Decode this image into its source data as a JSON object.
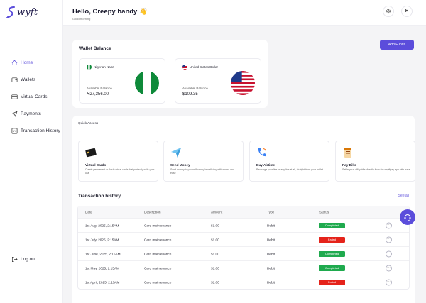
{
  "app": {
    "logo_text": "wyft",
    "brand_color": "#5b4ddb"
  },
  "sidebar": {
    "items": [
      {
        "label": "Home",
        "icon": "home-icon",
        "active": true
      },
      {
        "label": "Wallets",
        "icon": "wallet-icon"
      },
      {
        "label": "Virtual Cards",
        "icon": "card-icon"
      },
      {
        "label": "Payments",
        "icon": "send-icon"
      },
      {
        "label": "Transaction History",
        "icon": "history-icon"
      }
    ],
    "logout_label": "Log out"
  },
  "header": {
    "greeting": "Hello, Creepy handy 👋",
    "subtitle": "Good morning",
    "settings_icon": "gear-icon",
    "avatar_initial": "H"
  },
  "wallet": {
    "title": "Wallet Balance",
    "add_funds_label": "Add Funds",
    "balances": [
      {
        "currency": "Nigerian Naira",
        "label": "Available Balance",
        "amount": "₦27,356.00",
        "flag": "nigeria-flag"
      },
      {
        "currency": "United States Dollar",
        "label": "Available Balance",
        "amount": "$109.35",
        "flag": "usa-flag"
      }
    ]
  },
  "quick_access": {
    "title": "Quick Access",
    "items": [
      {
        "title": "Virtual Cards",
        "desc": "Create permanent or flash virtual cards that perfectly suits your use",
        "icon": "card-icon"
      },
      {
        "title": "Send Money",
        "desc": "Send money to yourself or any beneficiary with speed and ease",
        "icon": "paper-plane-icon"
      },
      {
        "title": "Buy Airtime",
        "desc": "Recharge your line or any line at all, straight from your wallet.",
        "icon": "phone-icon"
      },
      {
        "title": "Pay Bills",
        "desc": "Settle your utility bills directly from the swyftpay app with ease.",
        "icon": "receipt-icon"
      }
    ]
  },
  "transactions": {
    "title": "Transaction history",
    "see_all_label": "See all",
    "columns": [
      "Date",
      "Description",
      "Amount",
      "Type",
      "Status"
    ],
    "rows": [
      {
        "date": "1st Aug, 2025, 2:15AM",
        "description": "Card maintenance",
        "amount": "$1.00",
        "type": "Debit",
        "status": "Completed"
      },
      {
        "date": "1st July, 2025, 2:15AM",
        "description": "Card maintenance",
        "amount": "$1.00",
        "type": "Debit",
        "status": "Failed"
      },
      {
        "date": "1st June, 2025, 2:15AM",
        "description": "Card maintenance",
        "amount": "$1.00",
        "type": "Debit",
        "status": "Completed"
      },
      {
        "date": "1st May, 2025, 2:15AM",
        "description": "Card maintenance",
        "amount": "$1.00",
        "type": "Debit",
        "status": "Completed"
      },
      {
        "date": "1st April, 2025, 2:15AM",
        "description": "Card maintenance",
        "amount": "$1.00",
        "type": "Debit",
        "status": "Failed"
      }
    ],
    "status_colors": {
      "Completed": "#1faa4e",
      "Failed": "#e5231b"
    }
  },
  "support": {
    "icon": "headset-icon"
  }
}
